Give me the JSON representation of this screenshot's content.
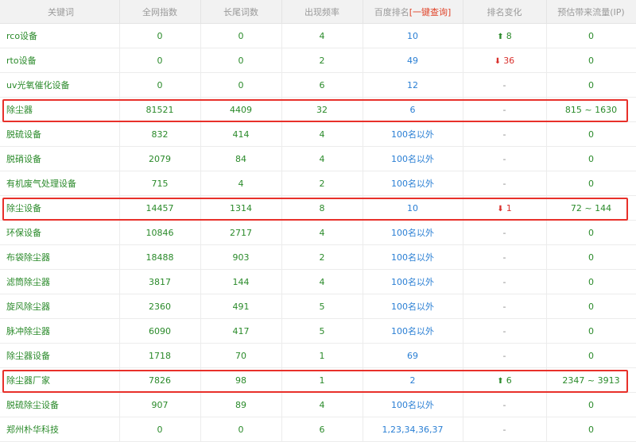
{
  "headers": {
    "keyword": "关键词",
    "index": "全网指数",
    "long_tail": "长尾词数",
    "frequency": "出现频率",
    "baidu_rank_prefix": "百度排名",
    "baidu_rank_link": "[一键查询]",
    "rank_change": "排名变化",
    "traffic": "预估带来流量(IP)"
  },
  "rows": [
    {
      "keyword": "rco设备",
      "index": "0",
      "long_tail": "0",
      "frequency": "4",
      "rank": "10",
      "change": "8",
      "change_dir": "up",
      "traffic": "0",
      "highlight": false
    },
    {
      "keyword": "rto设备",
      "index": "0",
      "long_tail": "0",
      "frequency": "2",
      "rank": "49",
      "change": "36",
      "change_dir": "down",
      "traffic": "0",
      "highlight": false
    },
    {
      "keyword": "uv光氧催化设备",
      "index": "0",
      "long_tail": "0",
      "frequency": "6",
      "rank": "12",
      "change": "-",
      "change_dir": "none",
      "traffic": "0",
      "highlight": false
    },
    {
      "keyword": "除尘器",
      "index": "81521",
      "long_tail": "4409",
      "frequency": "32",
      "rank": "6",
      "change": "-",
      "change_dir": "none",
      "traffic": "815 ~ 1630",
      "highlight": true
    },
    {
      "keyword": "脱硫设备",
      "index": "832",
      "long_tail": "414",
      "frequency": "4",
      "rank": "100名以外",
      "change": "-",
      "change_dir": "none",
      "traffic": "0",
      "highlight": false
    },
    {
      "keyword": "脱硝设备",
      "index": "2079",
      "long_tail": "84",
      "frequency": "4",
      "rank": "100名以外",
      "change": "-",
      "change_dir": "none",
      "traffic": "0",
      "highlight": false
    },
    {
      "keyword": "有机废气处理设备",
      "index": "715",
      "long_tail": "4",
      "frequency": "2",
      "rank": "100名以外",
      "change": "-",
      "change_dir": "none",
      "traffic": "0",
      "highlight": false
    },
    {
      "keyword": "除尘设备",
      "index": "14457",
      "long_tail": "1314",
      "frequency": "8",
      "rank": "10",
      "change": "1",
      "change_dir": "down",
      "traffic": "72 ~ 144",
      "highlight": true
    },
    {
      "keyword": "环保设备",
      "index": "10846",
      "long_tail": "2717",
      "frequency": "4",
      "rank": "100名以外",
      "change": "-",
      "change_dir": "none",
      "traffic": "0",
      "highlight": false
    },
    {
      "keyword": "布袋除尘器",
      "index": "18488",
      "long_tail": "903",
      "frequency": "2",
      "rank": "100名以外",
      "change": "-",
      "change_dir": "none",
      "traffic": "0",
      "highlight": false
    },
    {
      "keyword": "滤筒除尘器",
      "index": "3817",
      "long_tail": "144",
      "frequency": "4",
      "rank": "100名以外",
      "change": "-",
      "change_dir": "none",
      "traffic": "0",
      "highlight": false
    },
    {
      "keyword": "旋风除尘器",
      "index": "2360",
      "long_tail": "491",
      "frequency": "5",
      "rank": "100名以外",
      "change": "-",
      "change_dir": "none",
      "traffic": "0",
      "highlight": false
    },
    {
      "keyword": "脉冲除尘器",
      "index": "6090",
      "long_tail": "417",
      "frequency": "5",
      "rank": "100名以外",
      "change": "-",
      "change_dir": "none",
      "traffic": "0",
      "highlight": false
    },
    {
      "keyword": "除尘器设备",
      "index": "1718",
      "long_tail": "70",
      "frequency": "1",
      "rank": "69",
      "change": "-",
      "change_dir": "none",
      "traffic": "0",
      "highlight": false
    },
    {
      "keyword": "除尘器厂家",
      "index": "7826",
      "long_tail": "98",
      "frequency": "1",
      "rank": "2",
      "change": "6",
      "change_dir": "up",
      "traffic": "2347 ~ 3913",
      "highlight": true
    },
    {
      "keyword": "脱硫除尘设备",
      "index": "907",
      "long_tail": "89",
      "frequency": "4",
      "rank": "100名以外",
      "change": "-",
      "change_dir": "none",
      "traffic": "0",
      "highlight": false
    },
    {
      "keyword": "郑州朴华科技",
      "index": "0",
      "long_tail": "0",
      "frequency": "6",
      "rank": "1,23,34,36,37",
      "change": "-",
      "change_dir": "none",
      "traffic": "0",
      "highlight": false
    }
  ],
  "icons": {
    "up": "arrow-up-icon",
    "down": "arrow-down-icon"
  },
  "colors": {
    "text": "#2a8a2a",
    "rank": "#2a7fd4",
    "down": "#d9302c",
    "lookup": "#e0442a",
    "highlight_border": "#e8302a"
  }
}
